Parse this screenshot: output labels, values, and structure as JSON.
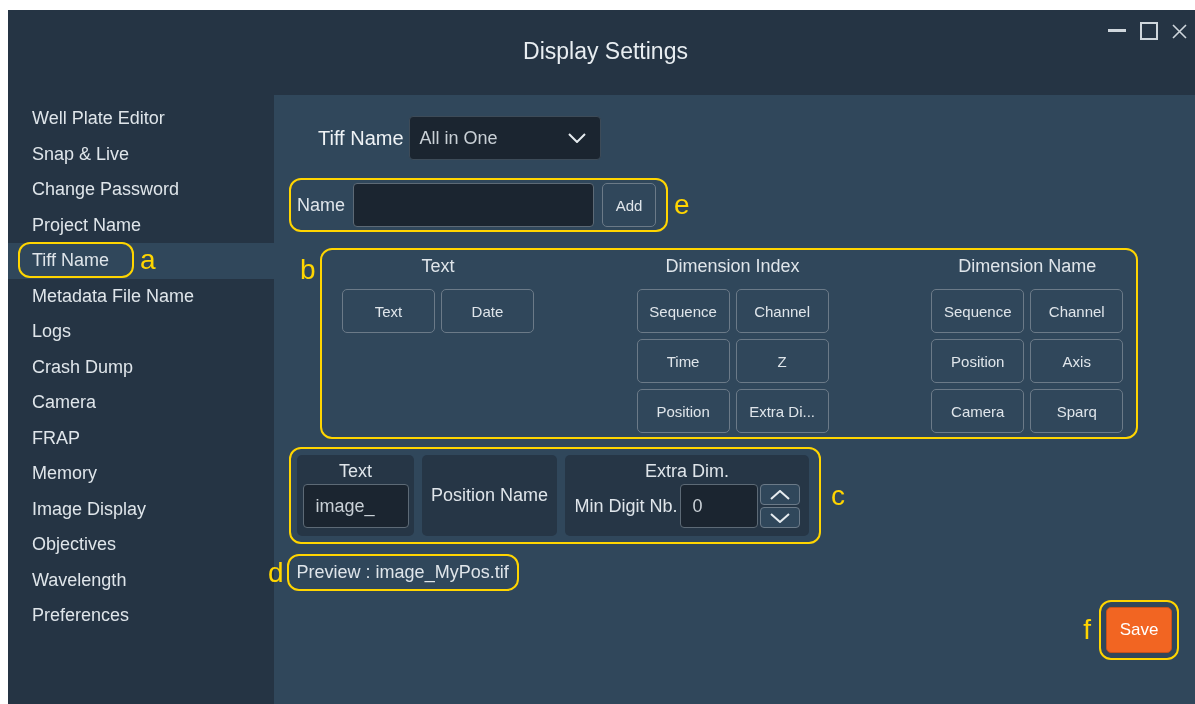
{
  "window": {
    "title": "Display Settings"
  },
  "sidebar": {
    "items": [
      {
        "label": "Well Plate Editor",
        "selected": false
      },
      {
        "label": "Snap & Live",
        "selected": false
      },
      {
        "label": "Change Password",
        "selected": false
      },
      {
        "label": "Project Name",
        "selected": false
      },
      {
        "label": "Tiff Name",
        "selected": true,
        "callout": "a"
      },
      {
        "label": "Metadata File Name",
        "selected": false
      },
      {
        "label": "Logs",
        "selected": false
      },
      {
        "label": "Crash Dump",
        "selected": false
      },
      {
        "label": "Camera",
        "selected": false
      },
      {
        "label": "FRAP",
        "selected": false
      },
      {
        "label": "Memory",
        "selected": false
      },
      {
        "label": "Image Display",
        "selected": false
      },
      {
        "label": "Objectives",
        "selected": false
      },
      {
        "label": "Wavelength",
        "selected": false
      },
      {
        "label": "Preferences",
        "selected": false
      }
    ]
  },
  "tiff_name": {
    "label": "Tiff Name",
    "value": "All in One"
  },
  "name_row": {
    "label": "Name",
    "button": "Add",
    "callout": "e"
  },
  "token_groups": {
    "callout": "b",
    "sections": [
      {
        "title": "Text",
        "buttons": [
          "Text",
          "Date"
        ]
      },
      {
        "title": "Dimension Index",
        "buttons": [
          "Sequence",
          "Channel",
          "Time",
          "Z",
          "Position",
          "Extra Di..."
        ]
      },
      {
        "title": "Dimension Name",
        "buttons": [
          "Sequence",
          "Channel",
          "Position",
          "Axis",
          "Camera",
          "Sparq"
        ]
      }
    ]
  },
  "segments": {
    "callout": "c",
    "items": [
      {
        "kind": "text_field",
        "title": "Text",
        "value": "image_"
      },
      {
        "kind": "label",
        "title": "Position Name"
      },
      {
        "kind": "spinner",
        "title": "Extra Dim.",
        "field_label": "Min Digit Nb.",
        "value": "0"
      }
    ]
  },
  "preview": {
    "text": "Preview : image_MyPos.tif",
    "callout": "d"
  },
  "save": {
    "label": "Save",
    "callout": "f"
  }
}
